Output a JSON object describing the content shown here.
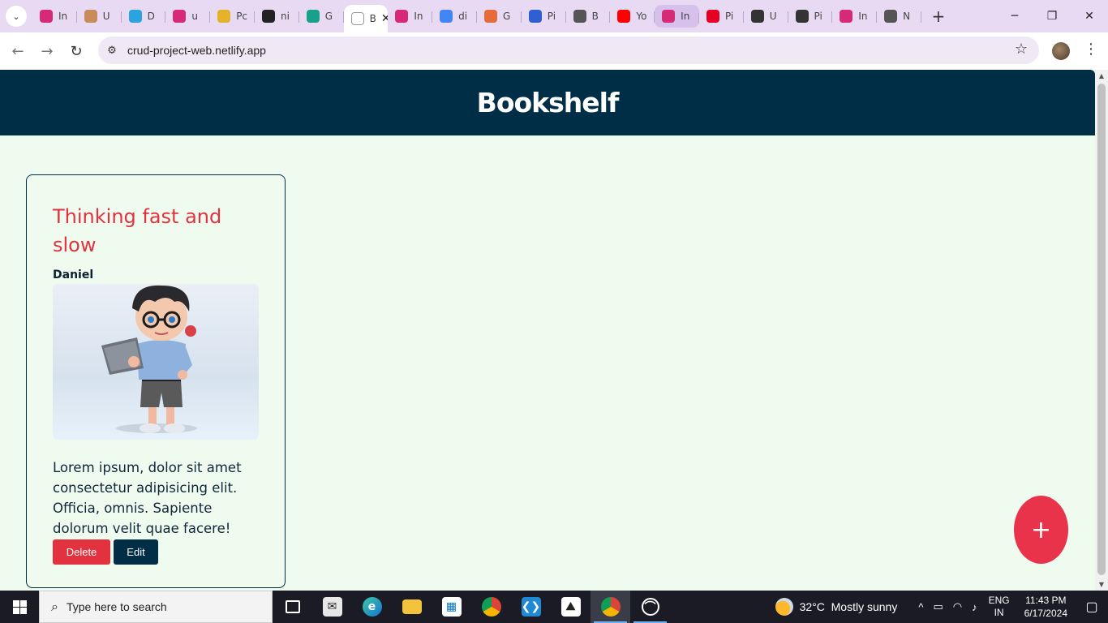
{
  "browser": {
    "tabs": [
      {
        "label": "In",
        "icon": "instagram-icon",
        "color": "#d62976"
      },
      {
        "label": "U",
        "icon": "avatar-icon",
        "color": "#c98a5c"
      },
      {
        "label": "D",
        "icon": "telegram-icon",
        "color": "#2aa3de"
      },
      {
        "label": "u",
        "icon": "instagram-icon",
        "color": "#d62976"
      },
      {
        "label": "Pc",
        "icon": "face-icon",
        "color": "#e3b32a"
      },
      {
        "label": "ni",
        "icon": "github-icon",
        "color": "#222222"
      },
      {
        "label": "G",
        "icon": "diamond-icon",
        "color": "#18a08d"
      },
      {
        "label": "B",
        "icon": "page-icon",
        "color": "#ffffff",
        "active": true
      },
      {
        "label": "In",
        "icon": "instagram-icon",
        "color": "#d62976"
      },
      {
        "label": "di",
        "icon": "google-icon",
        "color": "#4285f4"
      },
      {
        "label": "G",
        "icon": "grammarly-icon",
        "color": "#e66b3a"
      },
      {
        "label": "Pi",
        "icon": "jd-icon",
        "color": "#2f5fd0"
      },
      {
        "label": "B",
        "icon": "globe-icon",
        "color": "#555555"
      },
      {
        "label": "Yo",
        "icon": "youtube-icon",
        "color": "#ff0000"
      },
      {
        "label": "In",
        "icon": "instagram-icon",
        "color": "#d62976",
        "highlight": true
      },
      {
        "label": "Pi",
        "icon": "pinterest-icon",
        "color": "#e60023"
      },
      {
        "label": "U",
        "icon": "person-icon",
        "color": "#333333"
      },
      {
        "label": "Pi",
        "icon": "openai-icon",
        "color": "#333333"
      },
      {
        "label": "In",
        "icon": "instagram-icon",
        "color": "#d62976"
      },
      {
        "label": "N",
        "icon": "globe-icon",
        "color": "#555555"
      }
    ],
    "url": "crud-project-web.netlify.app"
  },
  "app": {
    "title": "Bookshelf"
  },
  "books": [
    {
      "title": "Thinking fast and slow",
      "author": "Daniel",
      "description": "Lorem ipsum, dolor sit amet consectetur adipisicing elit. Officia, omnis. Sapiente dolorum velit quae facere!",
      "delete_label": "Delete",
      "edit_label": "Edit"
    }
  ],
  "fab": {
    "label": "+"
  },
  "taskbar": {
    "search_placeholder": "Type here to search",
    "weather": {
      "temp": "32°C",
      "condition": "Mostly sunny"
    },
    "language": {
      "line1": "ENG",
      "line2": "IN"
    },
    "clock": {
      "time": "11:43 PM",
      "date": "6/17/2024"
    }
  },
  "colors": {
    "header_bg": "#002e47",
    "page_bg": "#f0fbef",
    "accent_red": "#e3323f",
    "fab_red": "#e8334a"
  }
}
